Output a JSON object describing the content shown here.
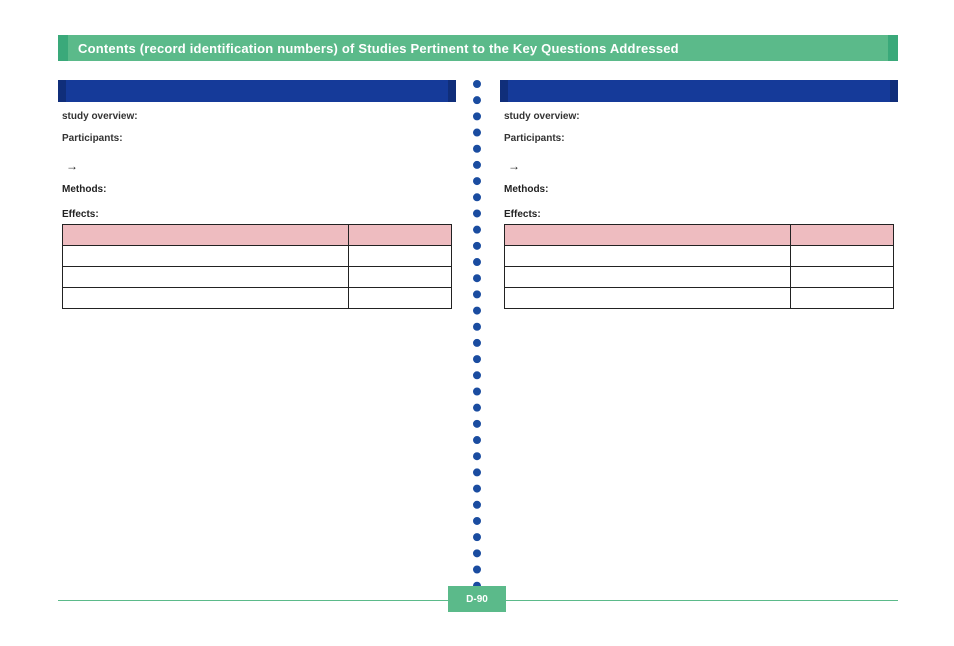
{
  "title": "Contents (record identification numbers) of Studies Pertinent to the Key Questions Addressed",
  "footer": {
    "page_label": "D-90",
    "left": "",
    "right": ""
  },
  "columns": [
    {
      "header": "",
      "overview_label": "study overview:",
      "overview": "",
      "participants_label": "Participants:",
      "participants": "",
      "problem_arrow": "→",
      "problem_from": "",
      "problem_to": "",
      "methods_label": "Methods:",
      "methods": "",
      "effects_title": "Effects:",
      "effects_headers": [
        "",
        ""
      ],
      "effects_rows": [
        [
          "",
          ""
        ],
        [
          "",
          ""
        ],
        [
          "",
          ""
        ]
      ],
      "analysis_label": "",
      "analysis": ""
    },
    {
      "header": "",
      "overview_label": "study overview:",
      "overview": "",
      "participants_label": "Participants:",
      "participants": "",
      "problem_arrow": "→",
      "problem_from": "",
      "problem_to": "",
      "methods_label": "Methods:",
      "methods": "",
      "effects_title": "Effects:",
      "effects_headers": [
        "",
        ""
      ],
      "effects_rows": [
        [
          "",
          ""
        ],
        [
          "",
          ""
        ],
        [
          "",
          ""
        ]
      ],
      "analysis_label": "",
      "analysis": ""
    }
  ]
}
